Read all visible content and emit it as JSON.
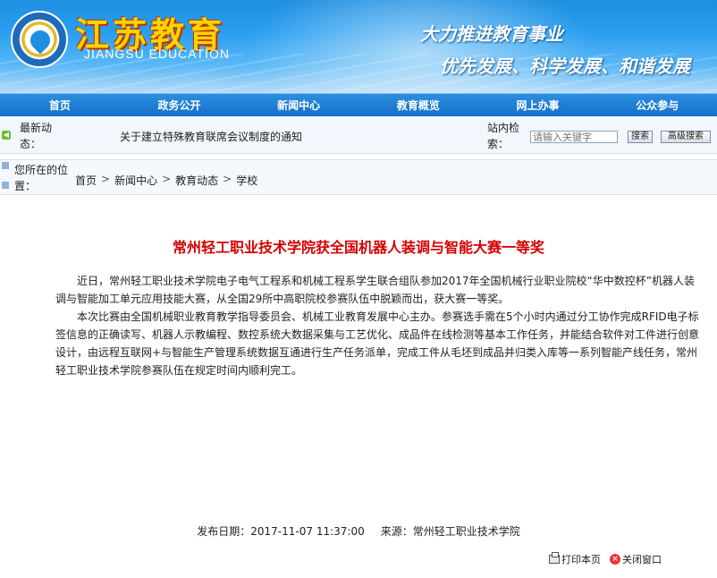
{
  "header": {
    "site_name": "江苏教育",
    "site_name_en": "JIANGSU EDUCATION",
    "slogan_line1": "大力推进教育事业",
    "slogan_line2": "优先发展、科学发展、和谐发展"
  },
  "nav": {
    "items": [
      "首页",
      "政务公开",
      "新闻中心",
      "教育概览",
      "网上办事",
      "公众参与"
    ]
  },
  "ticker": {
    "label": "最新动态：",
    "news": "关于建立特殊教育联席会议制度的通知",
    "search_label": "站内检索：",
    "search_placeholder": "请输入关键字",
    "search_button": "搜索",
    "advanced_button": "高级搜索"
  },
  "breadcrumb": {
    "label": "您所在的位置：",
    "items": [
      "首页",
      "新闻中心",
      "教育动态",
      "学校"
    ],
    "separator": ">"
  },
  "article": {
    "title": "常州轻工职业技术学院获全国机器人装调与智能大赛一等奖",
    "paragraph1": "　　近日，常州轻工职业技术学院电子电气工程系和机械工程系学生联合组队参加2017年全国机械行业职业院校“华中数控杯”机器人装调与智能加工单元应用技能大赛，从全国29所中高职院校参赛队伍中脱颖而出，获大赛一等奖。",
    "paragraph2": "　　本次比赛由全国机械职业教育教学指导委员会、机械工业教育发展中心主办。参赛选手需在5个小时内通过分工协作完成RFID电子标签信息的正确读写、机器人示教编程、数控系统大数据采集与工艺优化、成品件在线检测等基本工作任务，并能结合软件对工件进行创意设计，由远程互联网+与智能生产管理系统数据互通进行生产任务派单，完成工件从毛坯到成品并归类入库等一系列智能产线任务，常州轻工职业技术学院参赛队伍在规定时间内顺利完工。",
    "date_label": "发布日期：",
    "date": "2017-11-07 11:37:00",
    "source_label": "来源：",
    "source": "常州轻工职业技术学院"
  },
  "actions": {
    "print": "打印本页",
    "close": "关闭窗口"
  }
}
